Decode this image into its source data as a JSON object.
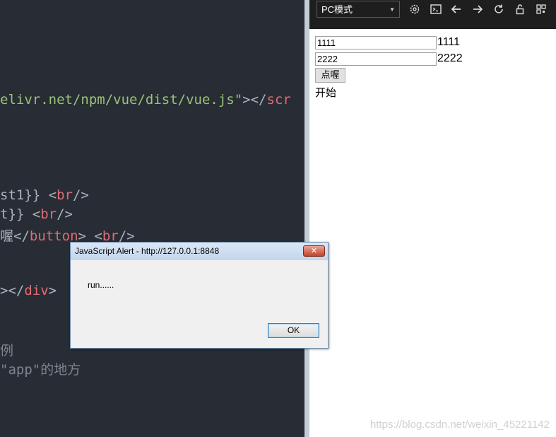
{
  "editor": {
    "lines": [
      {
        "id": "script-src",
        "segments": [
          {
            "cls": "c-str",
            "text": "elivr.net/npm/vue/dist/vue.js\""
          },
          {
            "cls": "c-txt",
            "text": "></"
          },
          {
            "cls": "c-tag",
            "text": "scr"
          }
        ]
      },
      {
        "id": "test1-line",
        "segments": [
          {
            "cls": "c-txt",
            "text": "st1}} <"
          },
          {
            "cls": "c-tag",
            "text": "br"
          },
          {
            "cls": "c-txt",
            "text": "/>"
          }
        ]
      },
      {
        "id": "test-line",
        "segments": [
          {
            "cls": "c-txt",
            "text": "t}} <"
          },
          {
            "cls": "c-tag",
            "text": "br"
          },
          {
            "cls": "c-txt",
            "text": "/>"
          }
        ]
      },
      {
        "id": "button-line",
        "segments": [
          {
            "cls": "c-txt",
            "text": "喔</"
          },
          {
            "cls": "c-tag",
            "text": "button"
          },
          {
            "cls": "c-txt",
            "text": "> <"
          },
          {
            "cls": "c-tag",
            "text": "br"
          },
          {
            "cls": "c-txt",
            "text": "/>"
          }
        ]
      },
      {
        "id": "div-close-line",
        "segments": [
          {
            "cls": "c-txt",
            "text": "></"
          },
          {
            "cls": "c-tag",
            "text": "div"
          },
          {
            "cls": "c-txt",
            "text": ">"
          }
        ]
      },
      {
        "id": "comment-line-1",
        "segments": [
          {
            "cls": "c-cmt",
            "text": "例"
          }
        ]
      },
      {
        "id": "comment-line-2",
        "segments": [
          {
            "cls": "c-cmt",
            "text": "\"app\"的地方"
          }
        ]
      }
    ]
  },
  "toolbar": {
    "mode_label": "PC模式",
    "icons": [
      "gear-icon",
      "console-icon",
      "arrow-left-icon",
      "arrow-right-icon",
      "refresh-icon",
      "unlock-icon",
      "qrcode-icon"
    ]
  },
  "preview": {
    "input1_value": "1111",
    "input1_echo": "1111",
    "input2_value": "2222",
    "input2_echo": "2222",
    "button_label": "点喔",
    "output_text": "开始",
    "watermark": "https://blog.csdn.net/weixin_45221142"
  },
  "dialog": {
    "title": "JavaScript Alert - http://127.0.0.1:8848",
    "close_label": "✕",
    "message": "run......",
    "ok_label": "OK"
  }
}
